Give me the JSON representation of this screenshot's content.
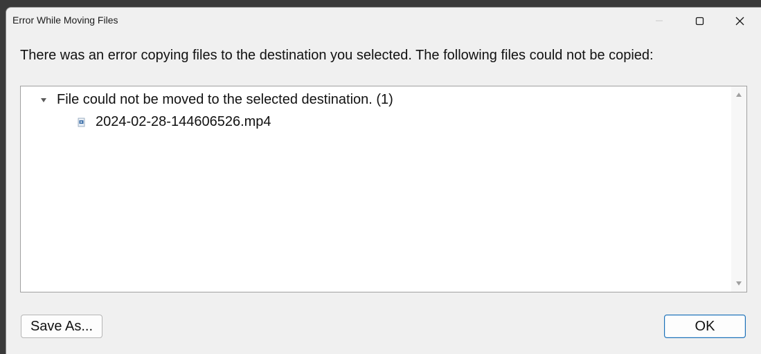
{
  "window": {
    "title": "Error While Moving Files"
  },
  "titlebar": {
    "buttons": [
      {
        "name": "minimize",
        "icon": "minimize-icon"
      },
      {
        "name": "maximize",
        "icon": "maximize-icon"
      },
      {
        "name": "close",
        "icon": "close-icon"
      }
    ]
  },
  "message": "There was an error copying files to the destination you selected. The following files could not be copied:",
  "list": {
    "groups": [
      {
        "label": "File could not be moved to the selected destination. (1)",
        "expanded": true,
        "expander_icon": "triangle-down-icon",
        "items": [
          {
            "label": "2024-02-28-144606526.mp4",
            "icon": "video-file-icon"
          }
        ]
      }
    ],
    "scrollbar": {
      "up_icon": "scroll-up-arrow-icon",
      "down_icon": "scroll-down-arrow-icon"
    }
  },
  "buttons": {
    "save_as": "Save As...",
    "ok": "OK"
  },
  "colors": {
    "window_bg": "#f0f0f0",
    "list_bg": "#ffffff",
    "ok_border": "#1a6fb5"
  }
}
